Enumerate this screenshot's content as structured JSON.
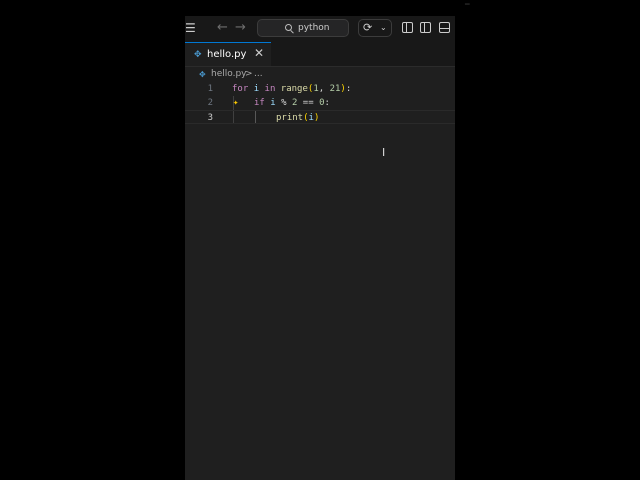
{
  "titlebar": {
    "search_text": "python",
    "menu_icon": "hamburger-icon",
    "back_icon": "arrow-left-icon",
    "forward_icon": "arrow-right-icon"
  },
  "tab": {
    "label": "hello.py",
    "close": "✕"
  },
  "breadcrumb": {
    "file": "hello.py",
    "separator": ">",
    "more": "..."
  },
  "code": {
    "lines": [
      {
        "number": "1",
        "text": "for i in range(1, 21):"
      },
      {
        "number": "2",
        "text": "if i % 2 == 0:"
      },
      {
        "number": "3",
        "text": "print(i)"
      }
    ]
  },
  "colors": {
    "keyword": "#c586c0",
    "variable": "#9cdcfe",
    "function": "#dcdcaa",
    "number": "#b5cea8",
    "editor_bg": "#1f1f1f"
  }
}
